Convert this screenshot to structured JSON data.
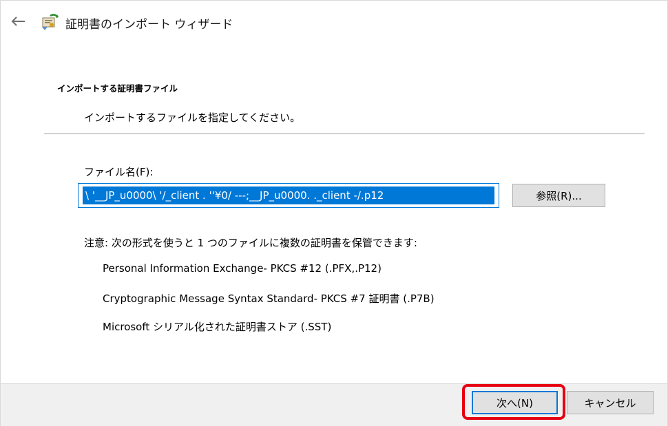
{
  "window": {
    "title": "証明書のインポート ウィザード",
    "icons": {
      "back": "back-arrow-icon",
      "wizard": "certificate-wizard-icon"
    }
  },
  "header": {
    "title": "インポートする証明書ファイル",
    "subtitle": "インポートするファイルを指定してください。"
  },
  "file": {
    "label": "ファイル名(F):",
    "value": "\\  '__JP_u0000\\    '/_client .   ''¥0/ ---;__JP_u0000.   ._client   -/.p12",
    "browse_label": "参照(R)..."
  },
  "notes": {
    "intro": "注意: 次の形式を使うと 1 つのファイルに複数の証明書を保管できます:",
    "formats": [
      "Personal Information Exchange- PKCS #12 (.PFX,.P12)",
      "Cryptographic Message Syntax Standard- PKCS #7 証明書 (.P7B)",
      "Microsoft シリアル化された証明書ストア (.SST)"
    ]
  },
  "footer": {
    "next_label": "次へ(N)",
    "cancel_label": "キャンセル"
  },
  "colors": {
    "accent": "#0078d7",
    "highlight": "#e60012",
    "footer_bg": "#f0f0f0",
    "button_bg": "#e1e1e1"
  }
}
